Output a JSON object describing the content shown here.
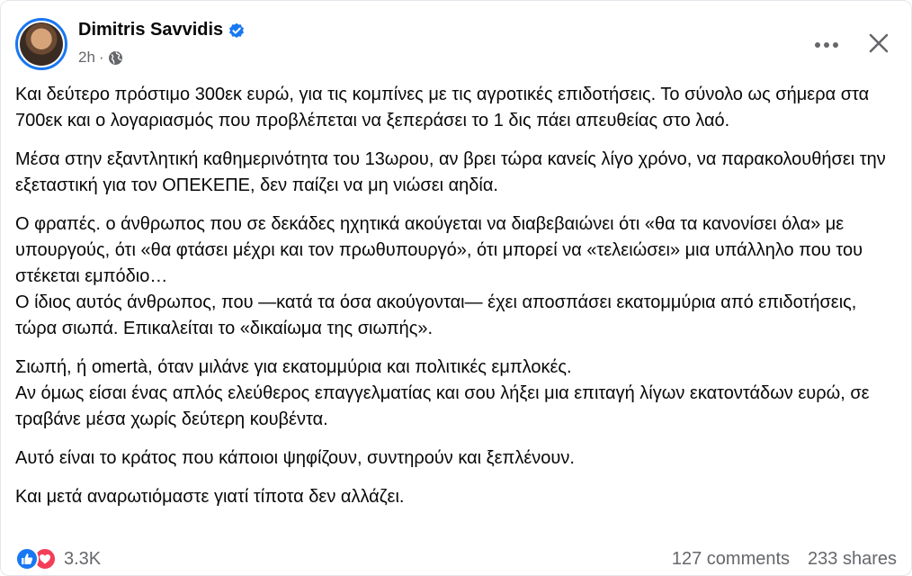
{
  "post": {
    "author": "Dimitris Savvidis",
    "time": "2h",
    "separator": "·",
    "paragraphs": [
      "Και δεύτερο πρόστιμο 300εκ ευρώ, για τις κομπίνες με τις αγροτικές επιδοτήσεις. Το σύνολο ως σήμερα στα 700εκ και ο λογαριασμός που προβλέπεται να ξεπεράσει το 1 δις πάει απευθείας στο λαό.",
      "Μέσα στην εξαντλητική καθημερινότητα του 13ωρου, αν βρει τώρα κανείς λίγο χρόνο, να παρακολουθήσει την εξεταστική για τον ΟΠΕΚΕΠΕ, δεν παίζει να μη νιώσει αηδία.",
      "Ο φραπές. ο άνθρωπος που σε δεκάδες ηχητικά ακούγεται να διαβεβαιώνει ότι «θα τα κανονίσει όλα» με υπουργούς, ότι «θα φτάσει μέχρι και τον πρωθυπουργό», ότι μπορεί να «τελειώσει» μια υπάλληλο που του στέκεται εμπόδιο…\nΟ ίδιος αυτός άνθρωπος, που —κατά τα όσα ακούγονται— έχει αποσπάσει εκατομμύρια από επιδοτήσεις, τώρα σιωπά. Επικαλείται το «δικαίωμα της σιωπής».",
      "Σιωπή, ή omertà, όταν μιλάνε για εκατομμύρια και πολιτικές εμπλοκές.\nΑν όμως είσαι ένας απλός ελεύθερος επαγγελματίας και σου λήξει μια επιταγή λίγων εκατοντάδων ευρώ, σε τραβάνε μέσα χωρίς δεύτερη κουβέντα.",
      "Αυτό είναι το κράτος που κάποιοι ψηφίζουν, συντηρούν και ξεπλένουν.",
      "Και μετά αναρωτιόμαστε γιατί τίποτα δεν αλλάζει."
    ],
    "reactions_count": "3.3K",
    "comments": "127 comments",
    "shares": "233 shares"
  },
  "icons": {
    "verified": "verified-badge-icon",
    "globe": "globe-icon",
    "more": "more-horizontal-icon",
    "close": "close-icon",
    "like": "like-reaction-icon",
    "love": "love-reaction-icon"
  },
  "colors": {
    "accent": "#1877f2",
    "love": "#f33e58",
    "secondary_text": "#65676b",
    "primary_text": "#080809"
  }
}
